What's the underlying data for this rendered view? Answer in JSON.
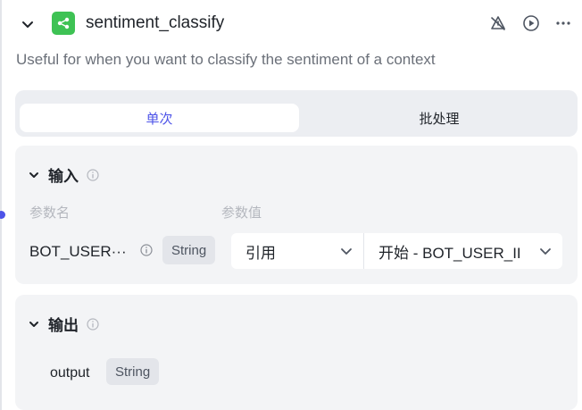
{
  "node": {
    "title": "sentiment_classify",
    "description": "Useful for when you want to classify the sentiment of a context"
  },
  "header_icons": [
    "chevron-down-icon",
    "plugin-node-icon",
    "no-alert-icon",
    "play-icon",
    "more-icon"
  ],
  "tabs": {
    "single": "单次",
    "batch": "批处理"
  },
  "input": {
    "title": "输入",
    "col_name": "参数名",
    "col_value": "参数值",
    "param": {
      "name": "BOT_USER···",
      "type": "String",
      "ref_mode": "引用",
      "value": "开始 - BOT_USER_II"
    }
  },
  "output": {
    "title": "输出",
    "param": {
      "name": "output",
      "type": "String"
    }
  },
  "colors": {
    "accent": "#4d53e8",
    "node_icon": "#3ec254",
    "card_bg": "#f3f4f6"
  }
}
